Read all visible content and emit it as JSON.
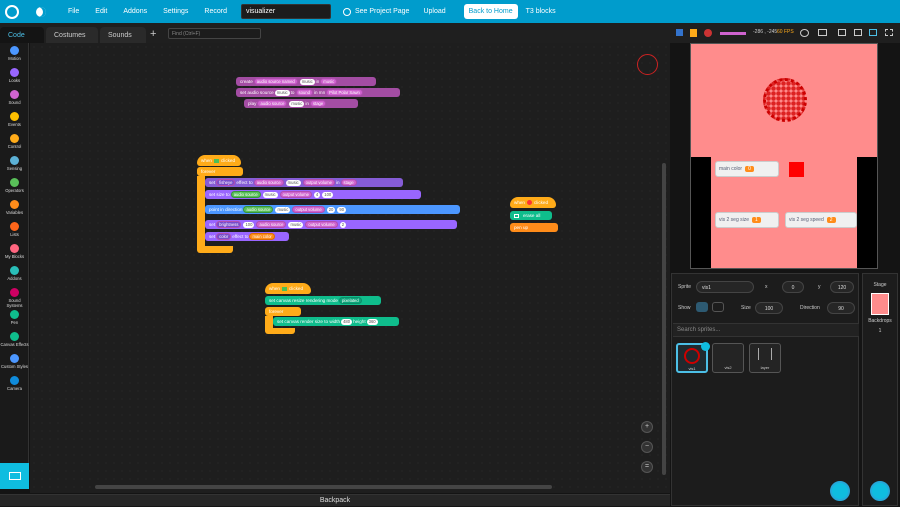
{
  "menubar": {
    "file": "File",
    "edit": "Edit",
    "addons": "Addons",
    "settings": "Settings",
    "record": "Record",
    "project_title": "visualizer",
    "see_project_page": "See Project Page",
    "upload": "Upload",
    "back_to_home": "Back to Home",
    "t3_blocks": "T3 blocks"
  },
  "tabs": {
    "code": "Code",
    "costumes": "Costumes",
    "sounds": "Sounds",
    "add": "+"
  },
  "find": {
    "placeholder": "Find (Ctrl+F)"
  },
  "categories": [
    {
      "label": "Motion",
      "color": "#4c97ff"
    },
    {
      "label": "Looks",
      "color": "#9966ff"
    },
    {
      "label": "Sound",
      "color": "#cf63cf"
    },
    {
      "label": "Events",
      "color": "#ffbf00"
    },
    {
      "label": "Control",
      "color": "#ffab19"
    },
    {
      "label": "Sensing",
      "color": "#5cb1d6"
    },
    {
      "label": "Operators",
      "color": "#59c059"
    },
    {
      "label": "Variables",
      "color": "#ff8c1a"
    },
    {
      "label": "Lists",
      "color": "#ff661a"
    },
    {
      "label": "My Blocks",
      "color": "#ff6680"
    },
    {
      "label": "Addons",
      "color": "#29beb8"
    },
    {
      "label": "Sound Systems",
      "color": "#cf0063"
    },
    {
      "label": "Pen",
      "color": "#0fbd8c"
    },
    {
      "label": "Canvas Effects",
      "color": "#0fbd8c"
    },
    {
      "label": "Custom Styles",
      "color": "#4c97ff"
    },
    {
      "label": "Camera",
      "color": "#0f8bdb"
    }
  ],
  "backpack": "Backpack",
  "stagebar": {
    "coords": "-286 , -245",
    "fps": "60 FPS"
  },
  "monitors": {
    "main_color": "main color",
    "main_color_val": "0",
    "seg_size": "vis 2 seg size",
    "seg_size_val": "1",
    "seg_speed": "vis 2 seg speed",
    "seg_speed_val": "2"
  },
  "sprite": {
    "label": "Sprite",
    "name": "vis1",
    "x_label": "x",
    "x": "0",
    "y_label": "y",
    "y": "120",
    "show": "Show",
    "size_label": "Size",
    "size": "100",
    "direction_label": "Direction",
    "direction": "90",
    "search": "Search sprites..."
  },
  "sprites": [
    {
      "name": "vis1"
    },
    {
      "name": "vis2"
    },
    {
      "name": "layer"
    }
  ],
  "stage_panel": {
    "title": "Stage",
    "backdrops": "Backdrops",
    "count": "1"
  },
  "zoom": {
    "in": "+",
    "out": "−",
    "reset": "="
  },
  "blocks": {
    "sound1": "create",
    "sound1b": "audio source named",
    "sound1c": "music",
    "sound1d": "in",
    "sound1e": "music",
    "sound2": "set audio source",
    "sound2b": "music",
    "sound2c": "to",
    "sound2d": "sound",
    "sound2e": "in mn",
    "sound2f": "Pilot Polar Sawn",
    "sound3": "play",
    "sound3b": "audio source",
    "sound3c": "music",
    "sound3d": "in",
    "sound3e": "stage",
    "when_flag": "when",
    "when_flag2": "clicked",
    "forever": "forever",
    "set_fisheye": "set",
    "fisheye": "fisheye",
    "effect_to": "effect to",
    "audio_src": "audio source",
    "music": "music",
    "out_vol": "output volume",
    "in": "in",
    "stage": "stage",
    "set_size": "set size to",
    "n4": "4",
    "n100": "100",
    "point_dir": "point in direction",
    "n20": "20",
    "n90": "90",
    "set_bright": "set",
    "brightness": "brightness",
    "n100b": "100",
    "n2": "2",
    "set_color": "set",
    "color": "color",
    "effect_to2": "effect to",
    "main_color": "main color",
    "when_flag3": "when",
    "clicked3": "clicked",
    "canvas_mode": "set canvas resize rendering mode",
    "pixelated": "pixelated",
    "forever3": "forever",
    "canvas_size": "set canvas render size to width",
    "w": "480",
    "height": "height",
    "h": "360",
    "when_click": "when",
    "clicked2": "clicked",
    "erase": "erase all",
    "pen_up": "pen up"
  }
}
